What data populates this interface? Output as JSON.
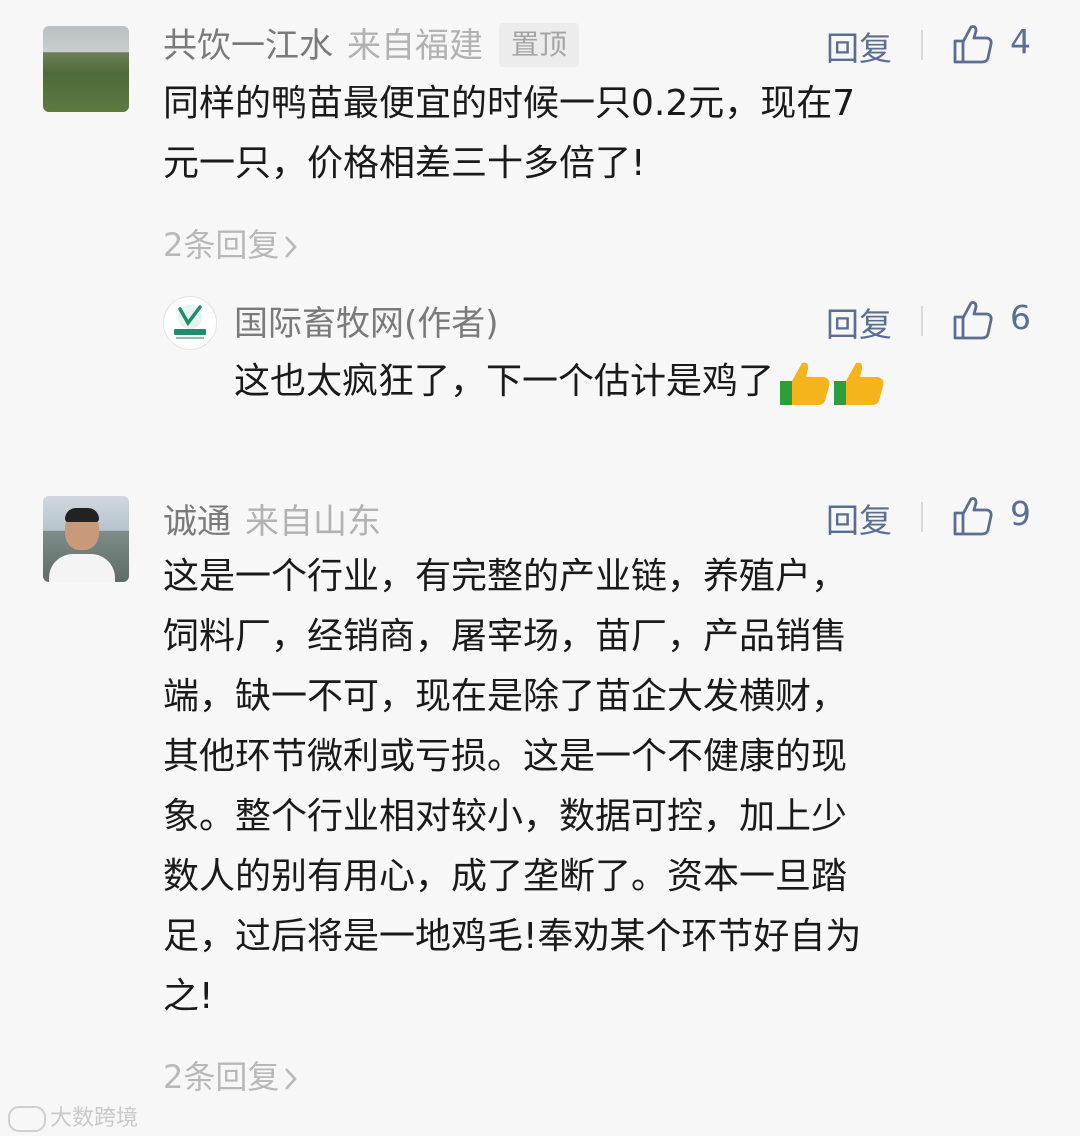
{
  "comments": [
    {
      "user": "共饮一江水",
      "location": "来自福建",
      "pin_label": "置顶",
      "reply_label": "回复",
      "likes": "4",
      "lines": [
        "同样的鸭苗最便宜的时候一只0.2元，现在7",
        "元一只，价格相差三十多倍了!"
      ],
      "replies_link": "2条回复"
    },
    {
      "user": "国际畜牧网(作者)",
      "reply_label": "回复",
      "likes": "6",
      "text": "这也太疯狂了，下一个估计是鸡了",
      "emojis": [
        "thumbs-up-emoji",
        "thumbs-up-emoji"
      ]
    },
    {
      "user": "诚通",
      "location": "来自山东",
      "reply_label": "回复",
      "likes": "9",
      "lines": [
        "这是一个行业，有完整的产业链，养殖户，",
        "饲料厂，经销商，屠宰场，苗厂，产品销售",
        "端，缺一不可，现在是除了苗企大发横财，",
        "其他环节微利或亏损。这是一个不健康的现",
        "象。整个行业相对较小，数据可控，加上少",
        "数人的别有用心，成了垄断了。资本一旦踏",
        "足，过后将是一地鸡毛!奉劝某个环节好自为",
        "之!"
      ],
      "replies_link": "2条回复"
    }
  ],
  "watermark": "大数跨境",
  "colors": {
    "link": "#5a6e93",
    "meta": "#b2b2b2",
    "text": "#1a1a1a"
  }
}
